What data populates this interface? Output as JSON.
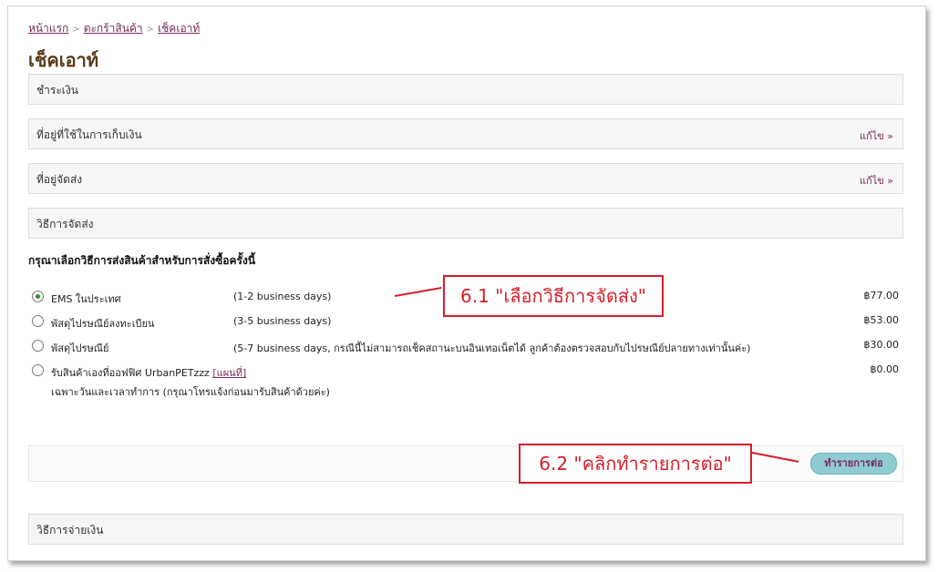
{
  "breadcrumb": {
    "home": "หน้าแรก",
    "cart": "ตะกร้าสินค้า",
    "checkout": "เช็คเอาท์",
    "separator": ">"
  },
  "page_title": "เช็คเอาท์",
  "sections": {
    "payment": "ชำระเงิน",
    "billing_address": "ที่อยู่ที่ใช้ในการเก็บเงิน",
    "shipping_address": "ที่อยู่จัดส่ง",
    "shipping_method": "วิธีการจัดส่ง",
    "payment_method": "วิธีการจ่ายเงิน",
    "edit_label": "แก้ไข »"
  },
  "shipping": {
    "prompt": "กรุณาเลือกวิธีการส่งสินค้าสำหรับการสั่งซื้อครั้งนี้",
    "options": [
      {
        "name": "EMS ในประเทศ",
        "desc": "(1-2 business days)",
        "price": "฿77.00",
        "selected": true
      },
      {
        "name": "พัสดุไปรษณีย์ลงทะเบียน",
        "desc": "(3-5 business days)",
        "price": "฿53.00",
        "selected": false
      },
      {
        "name": "พัสดุไปรษณีย์",
        "desc": "(5-7 business days, กรณีนี้ไม่สามารถเช็คสถานะบนอินเทอเน็ตได้ ลูกค้าต้องตรวจสอบกับไปรษณีย์ปลายทางเท่านั้นค่ะ)",
        "price": "฿30.00",
        "selected": false
      },
      {
        "name": "รับสินค้าเองที่ออฟฟิศ UrbanPETzzz",
        "map_link": "[แผนที่]",
        "note": "เฉพาะวันและเวลาทำการ (กรุณาโทรแจ้งก่อนมารับสินค้าด้วยค่ะ)",
        "price": "฿0.00",
        "selected": false
      }
    ]
  },
  "continue_button": "ทำรายการต่อ",
  "annotations": {
    "step1": "6.1 \"เลือกวิธีการจัดส่ง\"",
    "step2": "6.2 \"คลิกทำรายการต่อ\""
  },
  "colors": {
    "accent": "#7a2a5a",
    "button": "#8fcbd1",
    "callout": "#d61f2a",
    "radio_selected": "#3c8a3c"
  }
}
